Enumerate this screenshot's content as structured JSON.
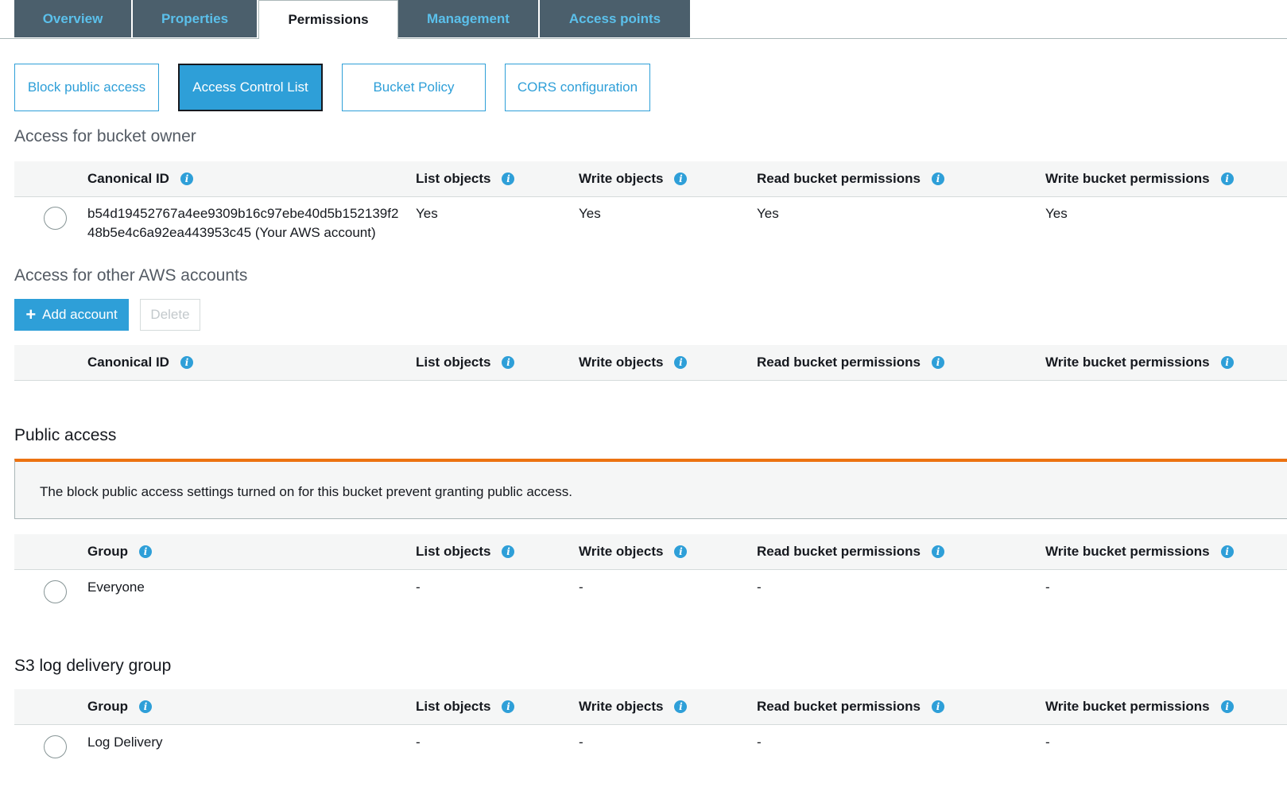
{
  "tabs": [
    {
      "label": "Overview",
      "active": false
    },
    {
      "label": "Properties",
      "active": false
    },
    {
      "label": "Permissions",
      "active": true
    },
    {
      "label": "Management",
      "active": false
    },
    {
      "label": "Access points",
      "active": false
    }
  ],
  "subtabs": [
    {
      "label": "Block public access",
      "active": false
    },
    {
      "label": "Access Control List",
      "active": true
    },
    {
      "label": "Bucket Policy",
      "active": false
    },
    {
      "label": "CORS configuration",
      "active": false
    }
  ],
  "owner_section": {
    "title": "Access for bucket owner",
    "headers": [
      "Canonical ID",
      "List objects",
      "Write objects",
      "Read bucket permissions",
      "Write bucket permissions"
    ],
    "row": {
      "id_line1": "b54d19452767a4ee9309b16c97ebe40d5b152139f2",
      "id_line2": "48b5e4c6a92ea443953c45 (Your AWS account)",
      "list_objects": "Yes",
      "write_objects": "Yes",
      "read_perms": "Yes",
      "write_perms": "Yes"
    }
  },
  "other_accounts": {
    "title": "Access for other AWS accounts",
    "add_button": "Add account",
    "delete_button": "Delete",
    "headers": [
      "Canonical ID",
      "List objects",
      "Write objects",
      "Read bucket permissions",
      "Write bucket permissions"
    ]
  },
  "public_access": {
    "title": "Public access",
    "alert": "The block public access settings turned on for this bucket prevent granting public access.",
    "headers": [
      "Group",
      "List objects",
      "Write objects",
      "Read bucket permissions",
      "Write bucket permissions"
    ],
    "row": {
      "group": "Everyone",
      "list_objects": "-",
      "write_objects": "-",
      "read_perms": "-",
      "write_perms": "-"
    }
  },
  "log_delivery": {
    "title": "S3 log delivery group",
    "headers": [
      "Group",
      "List objects",
      "Write objects",
      "Read bucket permissions",
      "Write bucket permissions"
    ],
    "row": {
      "group": "Log Delivery",
      "list_objects": "-",
      "write_objects": "-",
      "read_perms": "-",
      "write_perms": "-"
    }
  },
  "colors": {
    "accent": "#2e9fd8",
    "tab_bg": "#4b5f6c",
    "warning": "#ec7211"
  },
  "icons": {
    "info": "info-icon",
    "plus": "plus-icon"
  }
}
